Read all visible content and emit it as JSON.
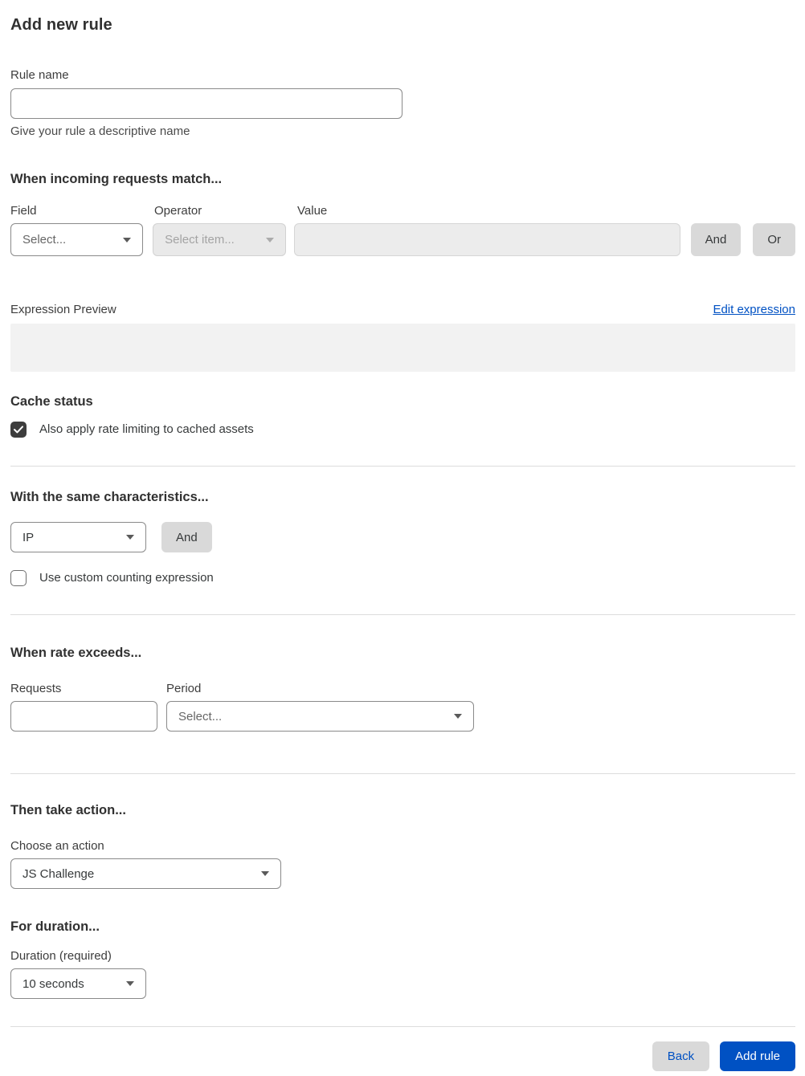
{
  "page": {
    "title": "Add new rule"
  },
  "rule_name": {
    "label": "Rule name",
    "value": "",
    "helper": "Give your rule a descriptive name"
  },
  "match": {
    "heading": "When incoming requests match...",
    "field": {
      "label": "Field",
      "selected": "Select..."
    },
    "operator": {
      "label": "Operator",
      "selected": "Select item...",
      "disabled": true
    },
    "value": {
      "label": "Value",
      "value": "",
      "disabled": true
    },
    "and_button": "And",
    "or_button": "Or"
  },
  "expression": {
    "label": "Expression Preview",
    "edit_link": "Edit expression",
    "preview_value": ""
  },
  "cache": {
    "heading": "Cache status",
    "checkbox_label": "Also apply rate limiting to cached assets",
    "checked": true
  },
  "characteristics": {
    "heading": "With the same characteristics...",
    "selected": "IP",
    "and_button": "And",
    "checkbox_label": "Use custom counting expression",
    "checked": false
  },
  "rate": {
    "heading": "When rate exceeds...",
    "requests": {
      "label": "Requests",
      "value": ""
    },
    "period": {
      "label": "Period",
      "selected": "Select..."
    }
  },
  "action": {
    "heading": "Then take action...",
    "label": "Choose an action",
    "selected": "JS Challenge"
  },
  "duration": {
    "heading": "For duration...",
    "label": "Duration (required)",
    "selected": "10 seconds"
  },
  "footer": {
    "back_button": "Back",
    "add_rule_button": "Add rule"
  },
  "icons": {
    "chevron_down": "chevron-down-icon",
    "checkmark": "checkmark-icon"
  },
  "colors": {
    "accent_blue": "#0051c3",
    "checkbox_checked": "#3d3d3d",
    "disabled_bg": "#e9e9e9",
    "button_gray": "#d9d9d9",
    "preview_bg": "#f2f2f2",
    "divider": "#dcdcdc"
  }
}
